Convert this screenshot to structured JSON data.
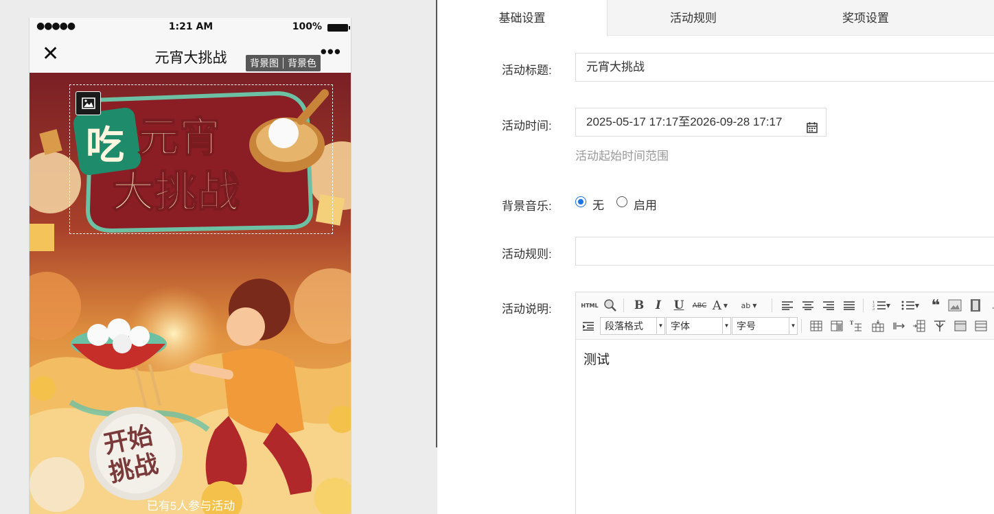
{
  "phone": {
    "status": {
      "signal": "●●●●●",
      "time": "1:21 AM",
      "battery": "100%"
    },
    "nav": {
      "close": "✕",
      "title": "元宵大挑战",
      "more": "•••"
    },
    "bg_tools": {
      "image": "背景图",
      "color": "背景色"
    },
    "poster": {
      "title_line1a": "吃",
      "title_line1b": "元宵",
      "title_line2": "大挑战",
      "start_line1": "开始",
      "start_line2": "挑战",
      "participants": "已有5人参与活动"
    }
  },
  "tabs": [
    {
      "label": "基础设置",
      "active": true
    },
    {
      "label": "活动规则",
      "active": false
    },
    {
      "label": "奖项设置",
      "active": false
    }
  ],
  "form": {
    "title_label": "活动标题:",
    "title_value": "元宵大挑战",
    "time_label": "活动时间:",
    "time_value": "2025-05-17 17:17至2026-09-28 17:17",
    "time_hint": "活动起始时间范围",
    "music_label": "背景音乐:",
    "music_options": [
      "无",
      "启用"
    ],
    "music_selected": "无",
    "rules_label": "活动规则:",
    "rules_value": "",
    "desc_label": "活动说明:",
    "desc_content": "测试"
  },
  "editor": {
    "html_btn": "HTML",
    "paragraph_select": "段落格式",
    "font_select": "字体",
    "size_select": "字号"
  },
  "colors": {
    "accent": "#1a73e8",
    "poster_red": "#8b1e24",
    "poster_gold": "#f5c16a"
  }
}
